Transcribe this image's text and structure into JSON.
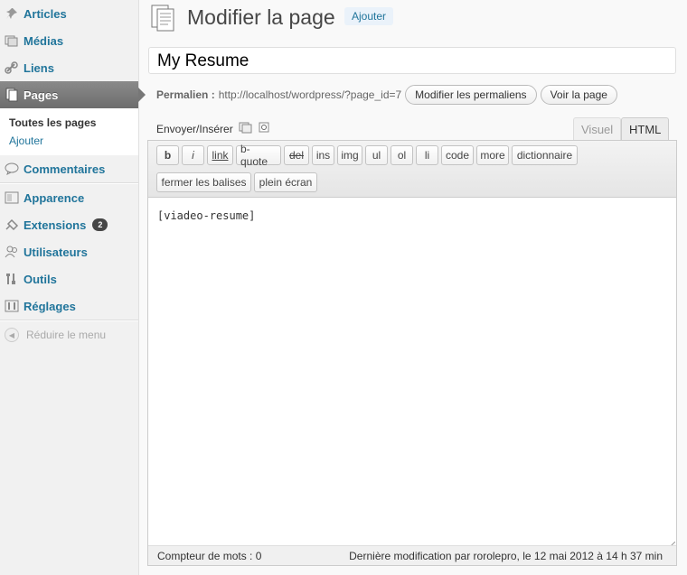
{
  "sidebar": {
    "items": [
      {
        "label": "Articles",
        "icon": "pushpin-icon"
      },
      {
        "label": "Médias",
        "icon": "media-icon"
      },
      {
        "label": "Liens",
        "icon": "link-icon"
      },
      {
        "label": "Pages",
        "icon": "pages-icon"
      }
    ],
    "submenu": [
      "Toutes les pages",
      "Ajouter"
    ],
    "items2": [
      {
        "label": "Commentaires",
        "icon": "comment-icon"
      },
      {
        "label": "Apparence",
        "icon": "appearance-icon"
      },
      {
        "label": "Extensions",
        "icon": "plugin-icon",
        "badge": "2"
      },
      {
        "label": "Utilisateurs",
        "icon": "users-icon"
      },
      {
        "label": "Outils",
        "icon": "tools-icon"
      },
      {
        "label": "Réglages",
        "icon": "settings-icon"
      }
    ],
    "collapse": "Réduire le menu"
  },
  "header": {
    "title": "Modifier la page",
    "add_new": "Ajouter"
  },
  "post": {
    "title": "My Resume",
    "permalink_label": "Permalien :",
    "permalink_url": "http://localhost/wordpress/?page_id=7",
    "edit_permalink": "Modifier les permaliens",
    "view_page": "Voir la page"
  },
  "media": {
    "label": "Envoyer/Insérer"
  },
  "tabs": {
    "visual": "Visuel",
    "html": "HTML"
  },
  "quicktags": {
    "row1": [
      "b",
      "i",
      "link",
      "b-quote",
      "del",
      "ins",
      "img",
      "ul",
      "ol",
      "li",
      "code",
      "more",
      "dictionnaire"
    ],
    "row2": [
      "fermer les balises",
      "plein écran"
    ]
  },
  "editor": {
    "content": "[viadeo-resume]"
  },
  "status": {
    "word_count": "Compteur de mots : 0",
    "last_modified": "Dernière modification par rorolepro, le 12 mai 2012 à 14 h 37 min"
  }
}
